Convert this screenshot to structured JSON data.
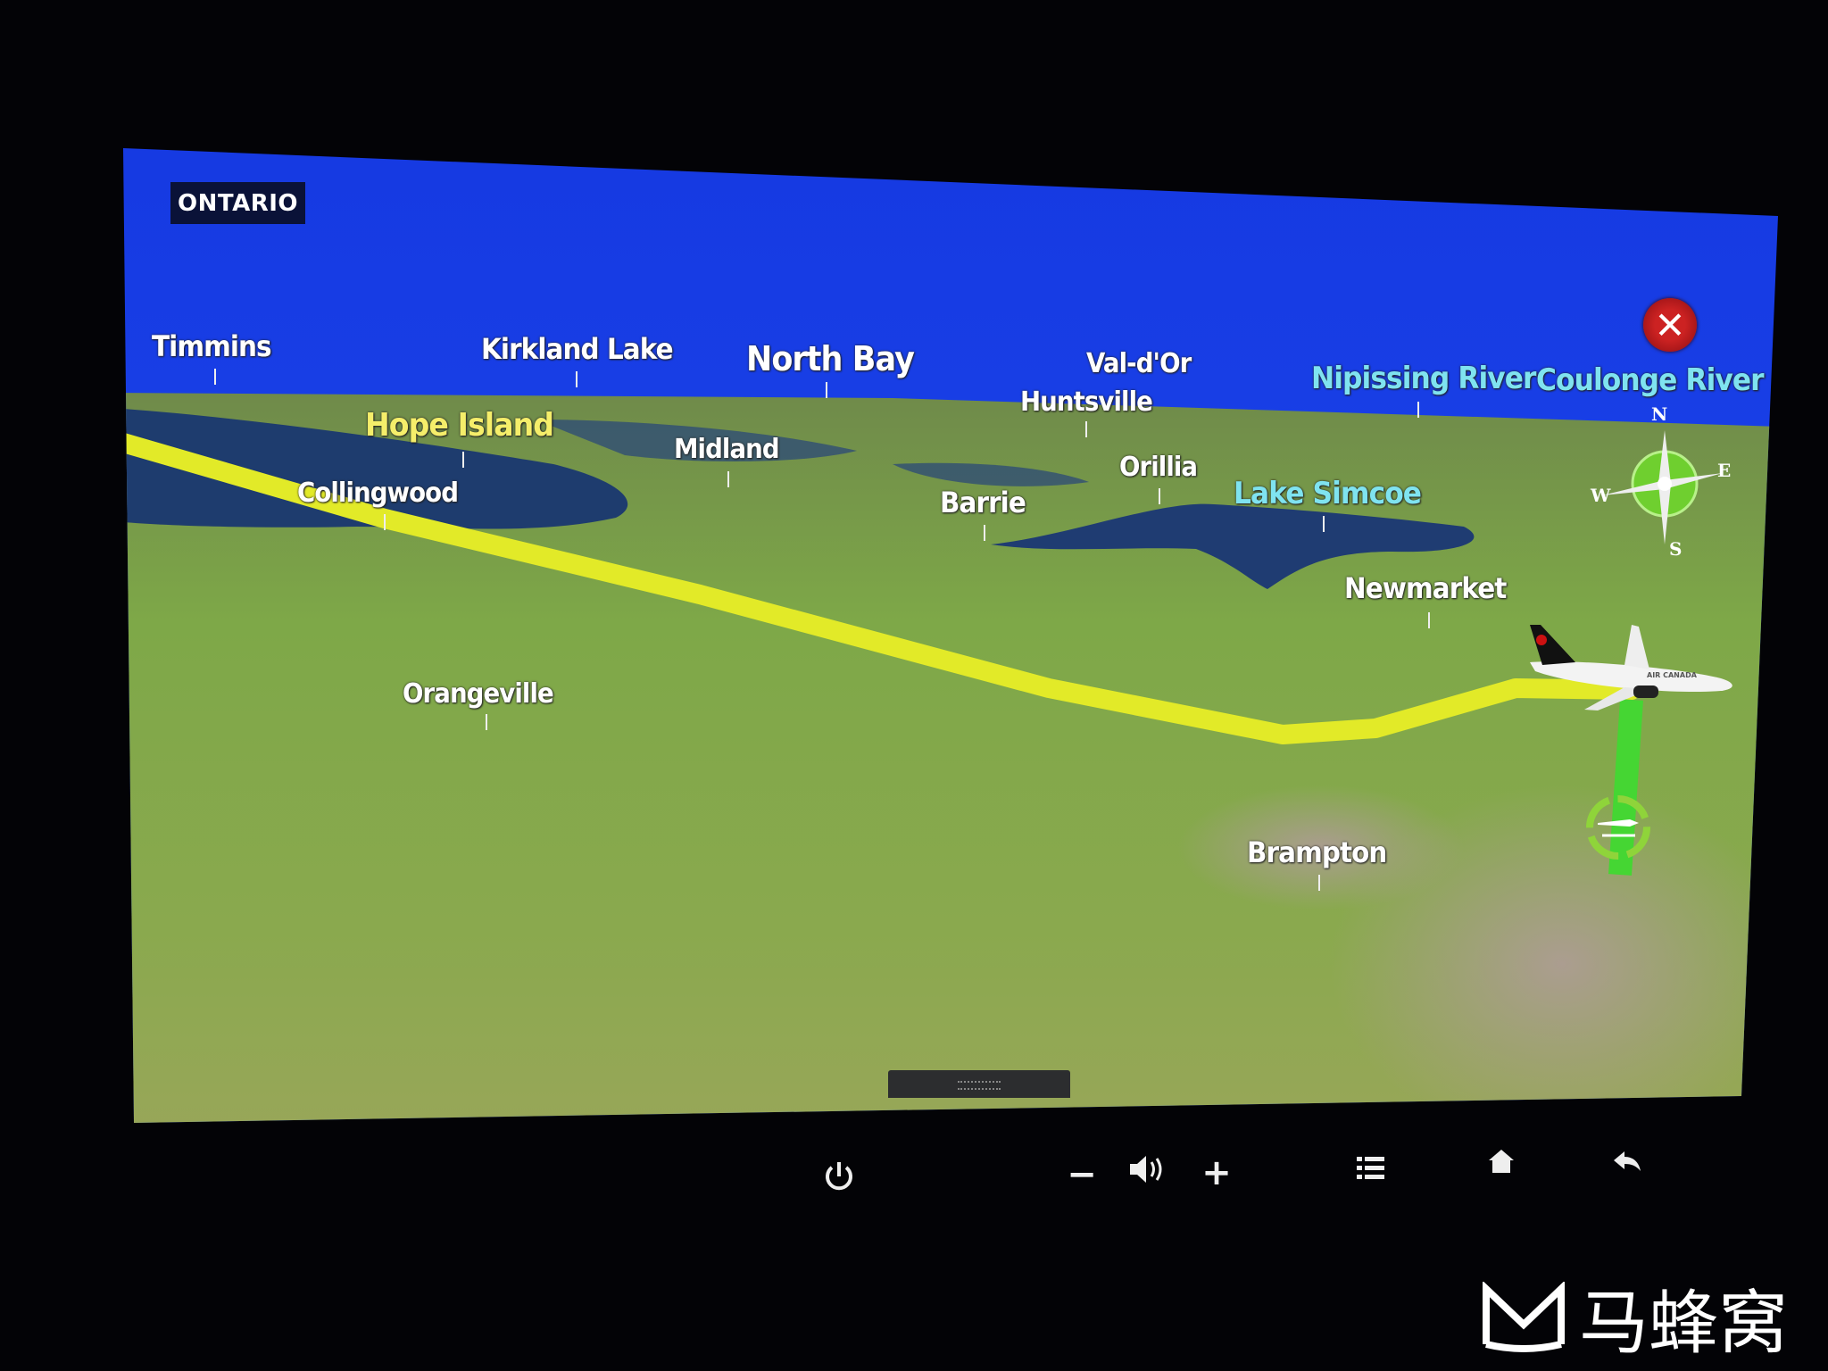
{
  "region_badge": "ONTARIO",
  "labels": {
    "timmins": "Timmins",
    "kirkland_lake": "Kirkland Lake",
    "north_bay": "North Bay",
    "val_dor": "Val-d'Or",
    "huntsville": "Huntsville",
    "nipissing_river": "Nipissing River",
    "coulonge_river": "Coulonge River",
    "hope_island": "Hope Island",
    "midland": "Midland",
    "collingwood": "Collingwood",
    "barrie": "Barrie",
    "orillia": "Orillia",
    "lake_simcoe": "Lake Simcoe",
    "newmarket": "Newmarket",
    "orangeville": "Orangeville",
    "brampton": "Brampton"
  },
  "compass": {
    "n": "N",
    "e": "E",
    "s": "S",
    "w": "W"
  },
  "aircraft_livery": "AIR CANADA",
  "close_icon": "close-icon",
  "controls": {
    "power": "power-icon",
    "volume_down": "−",
    "volume": "speaker-icon",
    "volume_up": "+",
    "menu": "list-icon",
    "home": "home-icon",
    "back": "back-icon"
  },
  "watermark": "马蜂窝",
  "colors": {
    "sky": "#1a3fe8",
    "flight_path": "#e6ee2a",
    "ground_track": "#46d633",
    "close": "#c22222"
  }
}
